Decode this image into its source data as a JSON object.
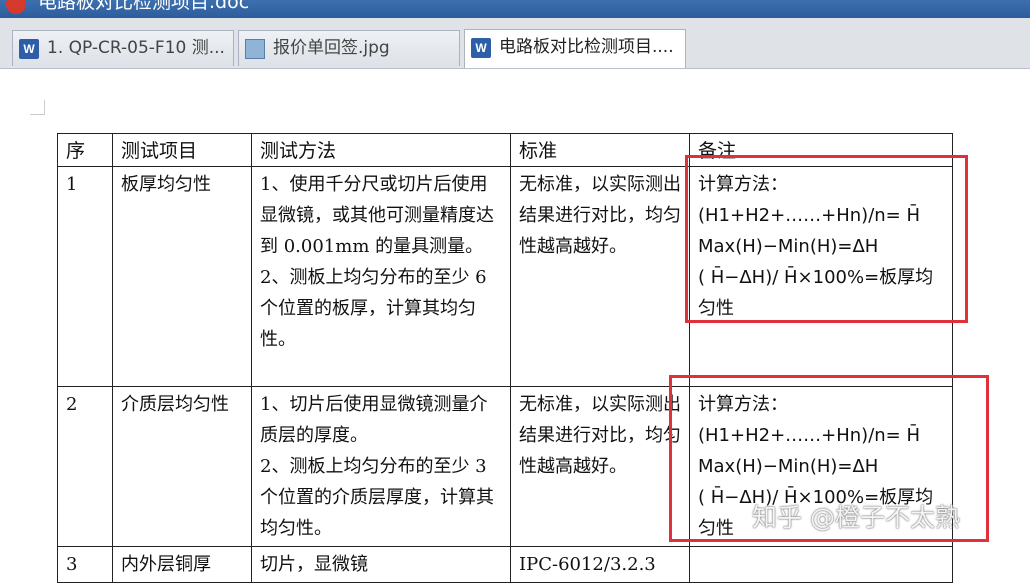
{
  "window": {
    "title": "电路板对比检测项目.doc"
  },
  "tabs": [
    {
      "label": "1. QP-CR-05-F10 测...",
      "icon": "word-doc-icon",
      "active": false
    },
    {
      "label": "报价单回签.jpg",
      "icon": "image-file-icon",
      "active": false
    },
    {
      "label": "电路板对比检测项目....",
      "icon": "word-doc-icon",
      "active": true
    }
  ],
  "table": {
    "headers": [
      "序",
      "测试项目",
      "测试方法",
      "标准",
      "备注"
    ],
    "rows": [
      {
        "no": "1",
        "item": "板厚均匀性",
        "method": [
          "1、使用千分尺或切片后使用显微镜，或其他可测量精度达到 0.001mm 的量具测量。",
          "2、测板上均匀分布的至少 6 个位置的板厚，计算其均匀性。"
        ],
        "standard": "无标准，以实际测出结果进行对比，均匀性越高越好。",
        "note": [
          "计算方法：",
          "(H1+H2+……+Hn)/n= H̄",
          "Max(H)−Min(H)=ΔH",
          "( H̄−ΔH)/ H̄×100%=板厚均匀性"
        ]
      },
      {
        "no": "2",
        "item": "介质层均匀性",
        "method": [
          "1、切片后使用显微镜测量介质层的厚度。",
          "2、测板上均匀分布的至少 3 个位置的介质层厚度，计算其均匀性。"
        ],
        "standard": "无标准，以实际测出结果进行对比，均匀性越高越好。",
        "note": [
          "计算方法：",
          "(H1+H2+……+Hn)/n= H̄",
          "Max(H)−Min(H)=ΔH",
          "( H̄−ΔH)/ H̄×100%=板厚均匀性"
        ]
      },
      {
        "no": "3",
        "item": "内外层铜厚",
        "method": [
          "切片，显微镜"
        ],
        "standard": "IPC-6012/3.2.3",
        "note": []
      }
    ]
  },
  "watermark": "知乎 @橙子不太熟",
  "colors": {
    "titlebar": "#2d5d9c",
    "highlight": "#e0303a"
  }
}
